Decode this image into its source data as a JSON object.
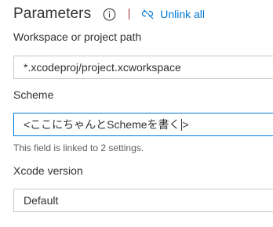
{
  "header": {
    "title": "Parameters",
    "info_icon": "info-icon",
    "unlink_icon": "unlink-icon",
    "unlink_label": "Unlink all"
  },
  "fields": {
    "workspace": {
      "label": "Workspace or project path",
      "value": "*.xcodeproj/project.xcworkspace"
    },
    "scheme": {
      "label": "Scheme",
      "value_before_caret": "<ここにちゃんとSchemeを書く",
      "value_after_caret": ">",
      "helper": "This field is linked to 2 settings."
    },
    "xcode_version": {
      "label": "Xcode version",
      "value": "Default"
    }
  },
  "colors": {
    "accent": "#0078d4",
    "divider": "#a4262c",
    "border": "#c8c6c4",
    "text": "#323130",
    "helper_text": "#605e5c"
  }
}
